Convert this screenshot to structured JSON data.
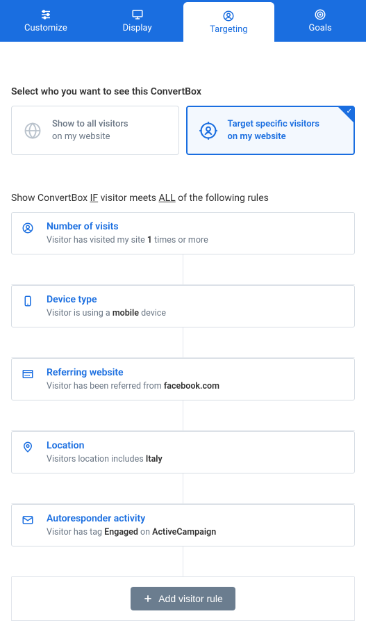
{
  "tabs": {
    "customize": "Customize",
    "display": "Display",
    "targeting": "Targeting",
    "goals": "Goals"
  },
  "audience": {
    "heading": "Select who you want to see this ConvertBox",
    "all": {
      "line1": "Show to all visitors",
      "line2": "on my website"
    },
    "specific": {
      "line1": "Target specific visitors",
      "line2": "on my website"
    }
  },
  "rules_heading": {
    "pre": "Show ConvertBox ",
    "if": "IF",
    "mid": " visitor meets ",
    "all": "ALL",
    "post": " of the following rules"
  },
  "rules": {
    "visits": {
      "title": "Number of visits",
      "d1": "Visitor has visited my site ",
      "bold": "1",
      "d2": " times or more"
    },
    "device": {
      "title": "Device type",
      "d1": "Visitor is using a ",
      "bold": "mobile",
      "d2": " device"
    },
    "referrer": {
      "title": "Referring website",
      "d1": "Visitor has been referred from ",
      "bold": "facebook.com",
      "d2": ""
    },
    "location": {
      "title": "Location",
      "d1": "Visitors location includes ",
      "bold": "Italy",
      "d2": ""
    },
    "autoresponder": {
      "title": "Autoresponder activity",
      "d1": "Visitor has tag ",
      "bold1": "Engaged",
      "mid": " on ",
      "bold2": "ActiveCampaign"
    }
  },
  "add_rule": "Add visitor rule"
}
